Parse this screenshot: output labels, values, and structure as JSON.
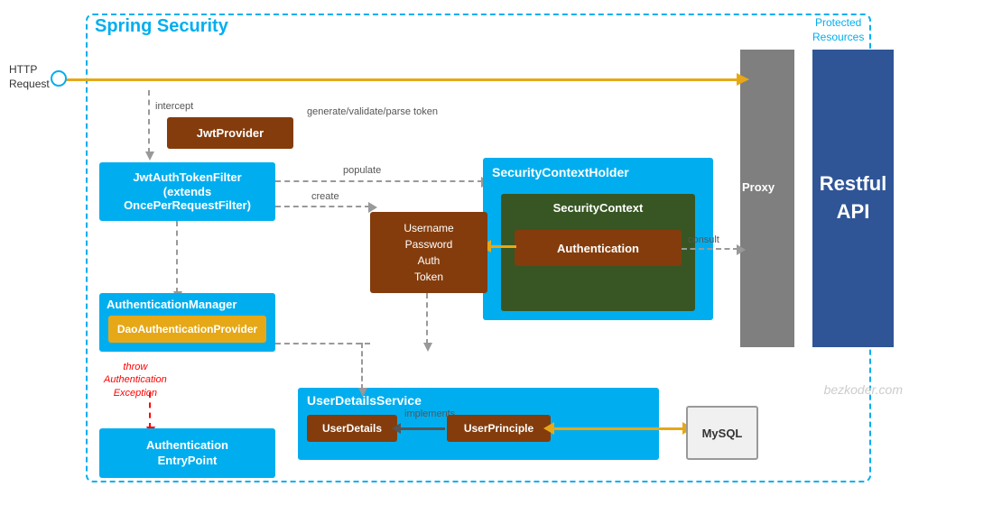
{
  "diagram": {
    "title": "Spring Security",
    "http_request": "HTTP\nRequest",
    "protected_resources": "Protected\nResources",
    "proxy": "Proxy",
    "restful_api": "Restful\nAPI",
    "jwt_provider": "JwtProvider",
    "gen_validate": "generate/validate/parse token",
    "intercept": "intercept",
    "jwt_filter": "JwtAuthTokenFilter\n(extends\nOncePerRequestFilter)",
    "jwt_filter_line1": "JwtAuthTokenFilter",
    "jwt_filter_line2": "(extends",
    "jwt_filter_line3": "OncePerRequestFilter)",
    "populate": "populate",
    "create": "create",
    "sec_context_holder": "SecurityContextHolder",
    "sec_context": "SecurityContext",
    "authentication": "Authentication",
    "token_box_line1": "Username",
    "token_box_line2": "Password",
    "token_box_line3": "Auth",
    "token_box_line4": "Token",
    "auth_manager": "AuthenticationManager",
    "dao_auth": "DaoAuthenticationProvider",
    "throw_label": "throw\nAuthentication\nException",
    "auth_entry": "Authentication\nEntryPoint",
    "user_details_service": "UserDetailsService",
    "user_details": "UserDetails",
    "implements": "implements",
    "user_principle": "UserPrinciple",
    "mysql": "MySQL",
    "consult": "consult",
    "watermark": "bezkoder.com"
  }
}
